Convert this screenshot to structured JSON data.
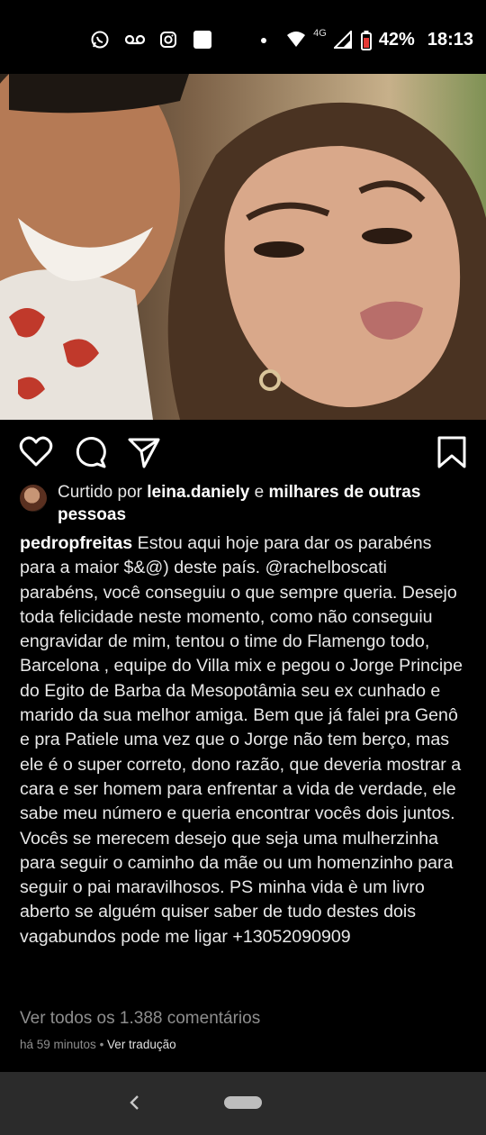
{
  "status_bar": {
    "icons": [
      "whatsapp-icon",
      "voicemail-icon",
      "instagram-icon",
      "square-icon",
      "dot-icon",
      "wifi-icon",
      "signal-icon",
      "battery-icon"
    ],
    "network": "4G",
    "battery": "42%",
    "time": "18:13"
  },
  "post": {
    "image_alt": "",
    "actions": [
      "like-icon",
      "comment-icon",
      "share-icon",
      "save-icon"
    ],
    "liked": {
      "prefix": "Curtido por ",
      "user": "leina.daniely",
      "middle": " e ",
      "others": "milhares de outras pessoas"
    },
    "caption": {
      "username": "pedropfreitas",
      "text_before_mention": " Estou aqui hoje para dar os parabéns para a maior $&@) deste país. ",
      "mention": "@rachelboscati",
      "text_after_mention": " parabéns, você conseguiu o que sempre queria. Desejo toda felicidade neste momento, como não conseguiu engravidar de mim, tentou o time do Flamengo todo, Barcelona , equipe do Villa mix e pegou o Jorge Principe do Egito de Barba da Mesopotâmia seu ex cunhado e marido da sua melhor amiga. Bem que já falei pra Genô  e pra Patiele uma vez que  o Jorge não tem berço, mas ele é o super correto, dono razão, que deveria mostrar a cara e ser homem para enfrentar a vida de verdade, ele sabe meu número e queria encontrar vocês dois juntos. Vocês se merecem desejo que seja uma mulherzinha para seguir o caminho da mãe ou um homenzinho para seguir o pai maravilhosos. PS minha vida è um livro aberto se alguém quiser saber de tudo destes dois vagabundos pode me ligar +13052090909"
    },
    "view_comments": "Ver todos os 1.388 comentários",
    "time_ago": "há 59 minutos",
    "separator": " • ",
    "translate": "Ver tradução"
  },
  "nav_bar": {
    "icons": [
      "back-icon",
      "home-pill-icon"
    ]
  }
}
